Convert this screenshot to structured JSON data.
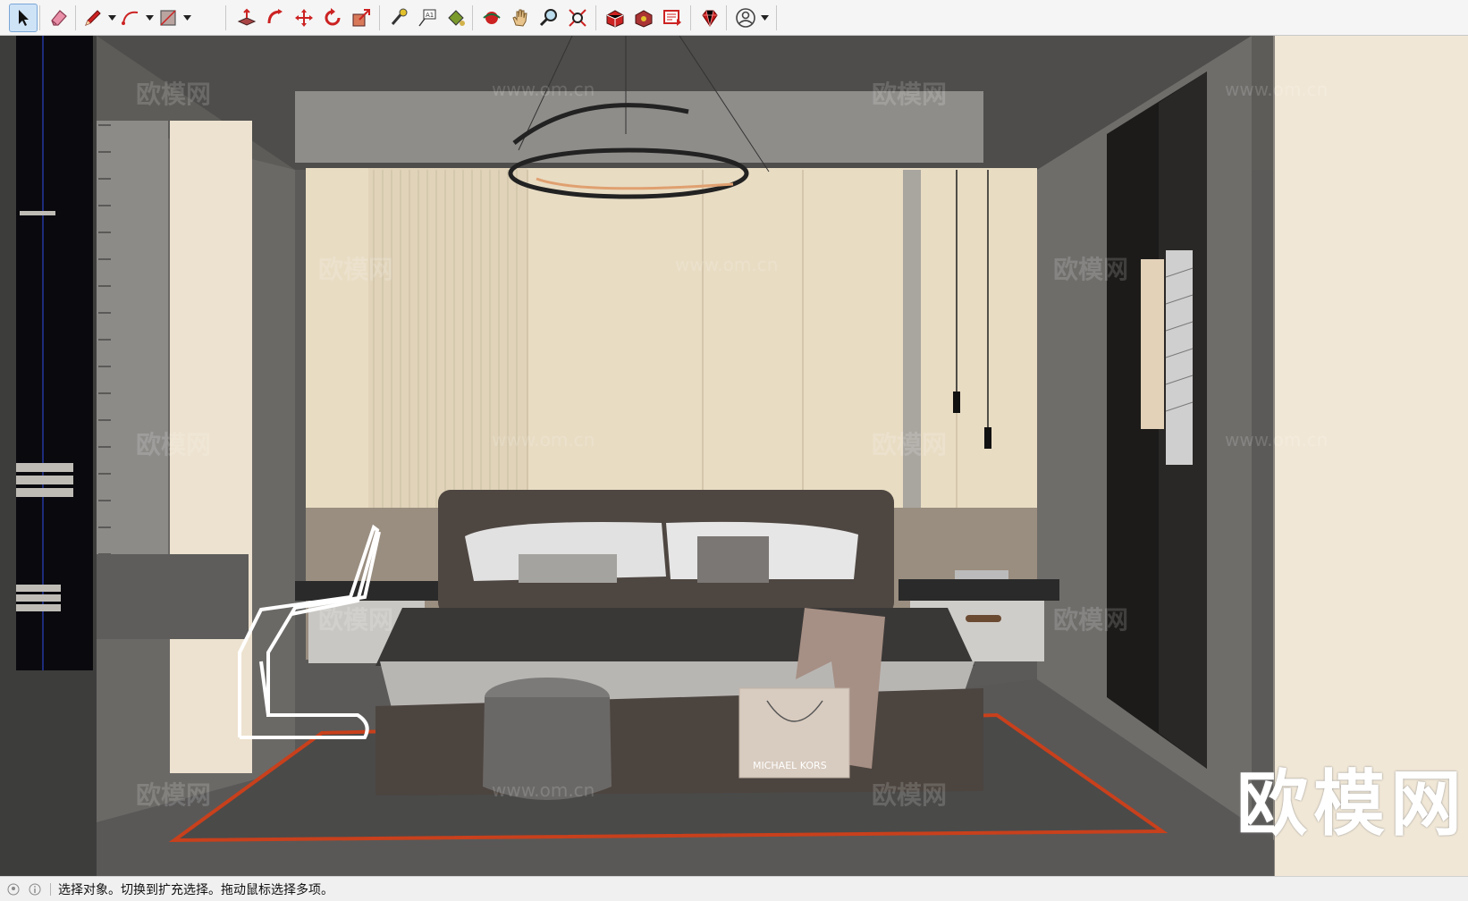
{
  "toolbar": {
    "groups": [
      {
        "tools": [
          {
            "name": "select-tool",
            "icon": "arrow-cursor-icon",
            "active": true
          }
        ]
      },
      {
        "tools": [
          {
            "name": "eraser-tool",
            "icon": "eraser-icon"
          }
        ]
      },
      {
        "tools": [
          {
            "name": "line-tool",
            "icon": "pencil-icon",
            "dropdown": true
          },
          {
            "name": "arc-tool",
            "icon": "arc-icon",
            "dropdown": true
          },
          {
            "name": "rectangle-tool",
            "icon": "rectangle-icon",
            "dropdown": true
          }
        ]
      },
      {
        "tools": [
          {
            "name": "push-pull-tool",
            "icon": "push-pull-icon"
          },
          {
            "name": "follow-me-tool",
            "icon": "follow-me-icon"
          },
          {
            "name": "move-tool",
            "icon": "move-icon"
          },
          {
            "name": "rotate-tool",
            "icon": "rotate-icon"
          },
          {
            "name": "scale-tool",
            "icon": "scale-icon"
          }
        ]
      },
      {
        "tools": [
          {
            "name": "tape-measure-tool",
            "icon": "tape-measure-icon"
          },
          {
            "name": "text-tool",
            "icon": "text-label-icon"
          },
          {
            "name": "paint-bucket-tool",
            "icon": "paint-bucket-icon"
          }
        ]
      },
      {
        "tools": [
          {
            "name": "orbit-tool",
            "icon": "orbit-icon"
          },
          {
            "name": "pan-tool",
            "icon": "hand-icon"
          },
          {
            "name": "zoom-tool",
            "icon": "magnifier-icon"
          },
          {
            "name": "zoom-extents-tool",
            "icon": "zoom-extents-icon"
          }
        ]
      },
      {
        "tools": [
          {
            "name": "3d-warehouse-button",
            "icon": "warehouse-icon"
          },
          {
            "name": "extension-warehouse-button",
            "icon": "extension-warehouse-icon"
          },
          {
            "name": "layout-button",
            "icon": "layout-icon"
          }
        ]
      },
      {
        "tools": [
          {
            "name": "ruby-console-button",
            "icon": "ruby-icon"
          }
        ]
      },
      {
        "tools": [
          {
            "name": "account-button",
            "icon": "user-icon",
            "dropdown": true
          }
        ]
      }
    ]
  },
  "viewport": {
    "watermark_brand": "欧模网",
    "watermark_text": "欧模网",
    "watermark_url": "www.om.cn",
    "bag_label": "MICHAEL KORS"
  },
  "status": {
    "text": "选择对象。切换到扩充选择。拖动鼠标选择多项。"
  },
  "colors": {
    "accent_active": "#cfe3f7",
    "rug_border": "#c8401c"
  }
}
